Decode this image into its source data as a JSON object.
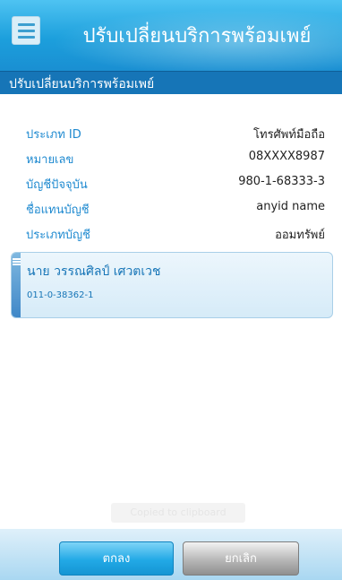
{
  "header": {
    "title": "ปรับเปลี่ยนบริการพร้อมเพย์",
    "menu_icon": "menu-icon"
  },
  "subheader": {
    "title": "ปรับเปลี่ยนบริการพร้อมเพย์"
  },
  "details": [
    {
      "label": "ประเภท ID",
      "value": "โทรศัพท์มือถือ"
    },
    {
      "label": "หมายเลข",
      "value": "08XXXX8987"
    },
    {
      "label": "บัญชีปัจจุบัน",
      "value": "980-1-68333-3"
    },
    {
      "label": "ชื่อแทนบัญชี",
      "value": "anyid name"
    },
    {
      "label": "ประเภทบัญชี",
      "value": "ออมทรัพย์"
    }
  ],
  "account_card": {
    "name": "นาย วรรณศิลป์ เศวตเวช",
    "account_no": "011-0-38362-1",
    "icon": "list-icon"
  },
  "toast": "Copied to clipboard",
  "footer": {
    "ok_label": "ตกลง",
    "cancel_label": "ยกเลิก"
  },
  "colors": {
    "header_blue": "#1c9fdc",
    "subheader_blue": "#1675b7",
    "label_blue": "#1f8ad0"
  }
}
